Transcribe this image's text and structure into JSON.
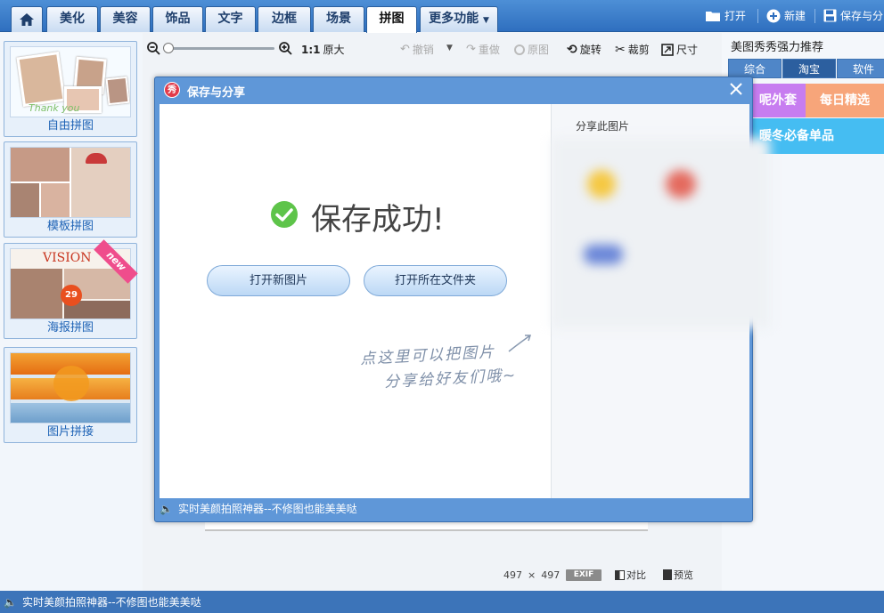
{
  "tabs": [
    {
      "label": "美化"
    },
    {
      "label": "美容"
    },
    {
      "label": "饰品"
    },
    {
      "label": "文字"
    },
    {
      "label": "边框"
    },
    {
      "label": "场景"
    },
    {
      "label": "拼图"
    },
    {
      "label": "更多功能"
    }
  ],
  "top_actions": {
    "open": "打开",
    "new": "新建",
    "save_share": "保存与分"
  },
  "templates": [
    {
      "label": "自由拼图",
      "badge": ""
    },
    {
      "label": "模板拼图",
      "badge": ""
    },
    {
      "label": "海报拼图",
      "badge": "new"
    },
    {
      "label": "图片拼接",
      "badge": ""
    }
  ],
  "template_art": {
    "thanks_text": "Thank you",
    "vision_text": "VISION",
    "poster_number": "29"
  },
  "toolbar": {
    "zoom_ratio": "1:1",
    "original_size": "原大",
    "undo": "撤销",
    "redo": "重做",
    "original": "原图",
    "rotate": "旋转",
    "crop": "裁剪",
    "size": "尺寸"
  },
  "right_panel": {
    "title": "美图秀秀强力推荐",
    "tabs": [
      "综合",
      "淘宝",
      "软件"
    ],
    "active_tab": "淘宝",
    "banners": [
      "呢外套",
      "每日精选",
      "暖冬必备单品"
    ]
  },
  "dialog": {
    "title": "保存与分享",
    "app_icon": "秀",
    "success_text": "保存成功!",
    "btn_open_new": "打开新图片",
    "btn_open_folder": "打开所在文件夹",
    "hint_line1": "点这里可以把图片",
    "hint_line2": "分享给好友们哦~",
    "share_title": "分享此图片",
    "footer_text": "实时美颜拍照神器--不修图也能美美哒"
  },
  "bottom_info": {
    "width": "497",
    "times": "×",
    "height": "497",
    "exif": "EXIF",
    "compare": "对比",
    "preview": "预览"
  },
  "status_bar": {
    "text": "实时美颜拍照神器--不修图也能美美哒"
  },
  "colors": {
    "brand_blue": "#3c74b9",
    "success_green": "#5ec44a",
    "banner_purple": "#c77df0",
    "banner_peach": "#f7a57a",
    "banner_sky": "#45bdf2"
  }
}
